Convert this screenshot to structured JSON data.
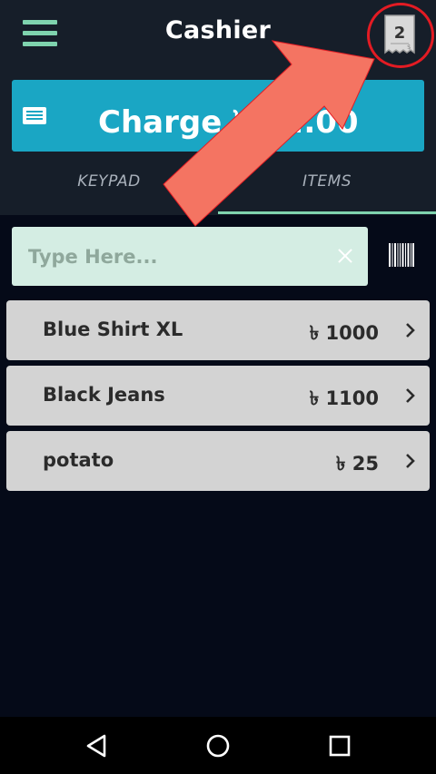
{
  "header": {
    "title": "Cashier",
    "receipt_count": "2"
  },
  "charge": {
    "label": "Charge ৳ 6...00"
  },
  "tabs": [
    {
      "label": "KEYPAD",
      "active": false
    },
    {
      "label": "ITEMS",
      "active": true
    }
  ],
  "search": {
    "value": "",
    "placeholder": "Type Here..."
  },
  "items": [
    {
      "name": "Blue Shirt XL",
      "price": "৳ 1000"
    },
    {
      "name": "Black Jeans",
      "price": "৳ 1100"
    },
    {
      "name": "potato",
      "price": "৳ 25"
    }
  ],
  "icons": {
    "menu": "hamburger-menu-icon",
    "receipt": "receipt-icon",
    "charge": "card-list-icon",
    "clear": "close-icon",
    "barcode": "barcode-icon",
    "chevron": "chevron-right-icon",
    "back": "nav-back-icon",
    "home": "nav-home-icon",
    "recents": "nav-recents-icon"
  },
  "colors": {
    "background": "#050a18",
    "appbar": "#161e29",
    "accent": "#7fd3ae",
    "charge_button": "#1aa6c4",
    "search_bg": "#d4ede3",
    "item_bg": "#d3d3d3",
    "annotation_arrow": "#f47462",
    "annotation_ring": "#e31b23"
  }
}
